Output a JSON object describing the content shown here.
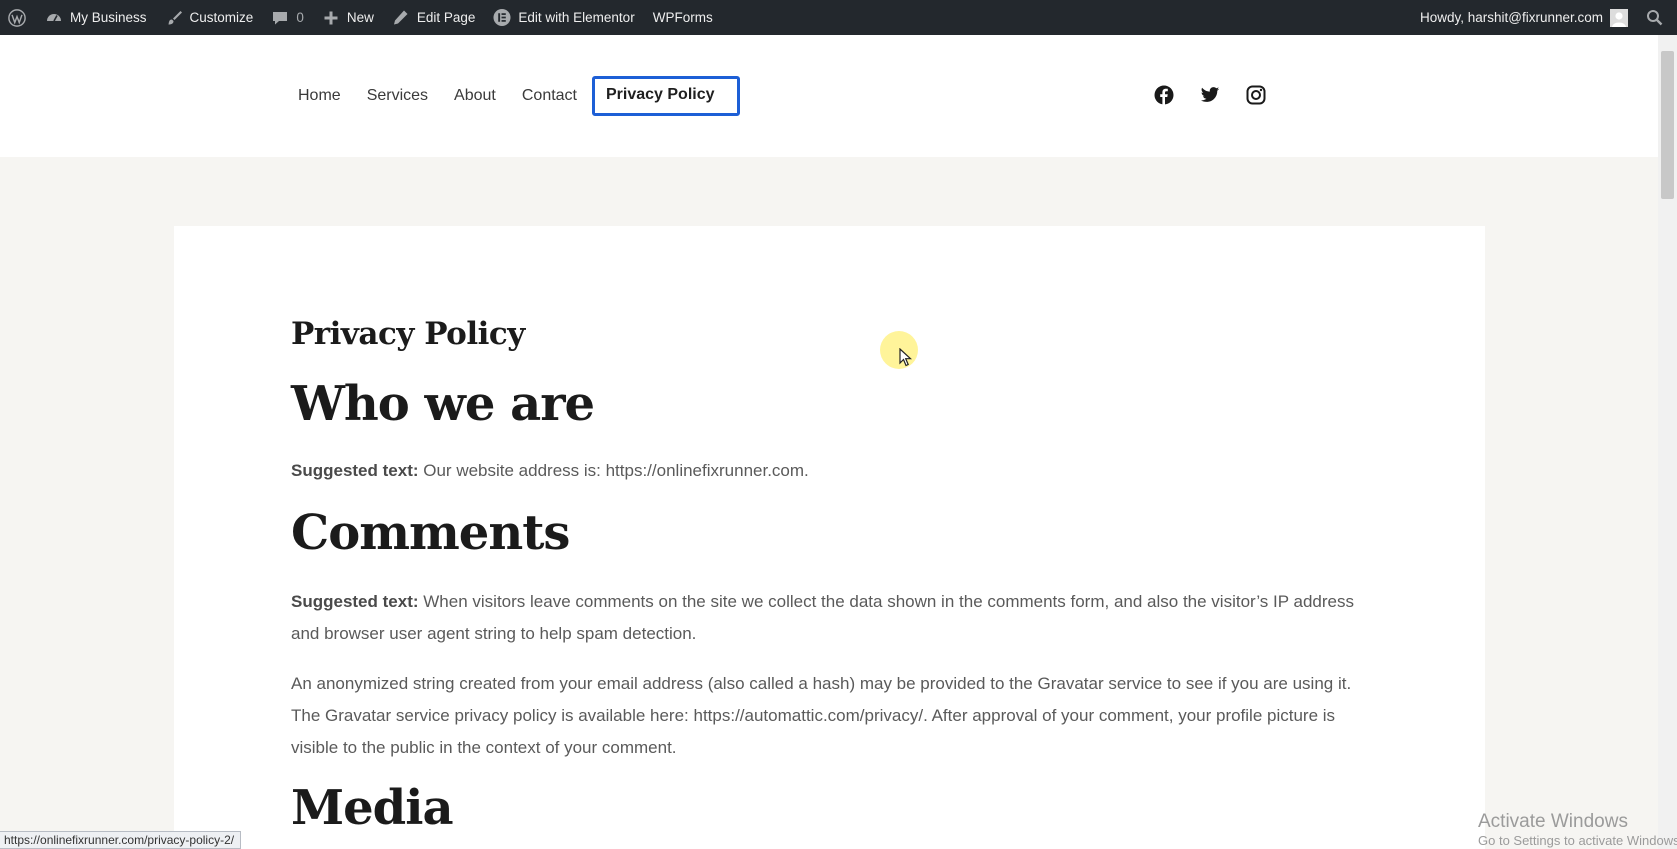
{
  "adminbar": {
    "site_name": "My Business",
    "customize": "Customize",
    "comments_count": "0",
    "new": "New",
    "edit_page": "Edit Page",
    "edit_elementor": "Edit with Elementor",
    "wpforms": "WPForms",
    "howdy": "Howdy, harshit@fixrunner.com"
  },
  "nav": {
    "items": [
      "Home",
      "Services",
      "About",
      "Contact",
      "Privacy Policy"
    ],
    "active": "Privacy Policy"
  },
  "content": {
    "page_title": "Privacy Policy",
    "who_heading": "Who we are",
    "suggested_label": "Suggested text:",
    "who_text": " Our website address is: https://onlinefixrunner.com.",
    "comments_heading": "Comments",
    "comments_text_1": " When visitors leave comments on the site we collect the data shown in the comments form, and also the visitor’s IP address and browser user agent string to help spam detection.",
    "comments_text_2": "An anonymized string created from your email address (also called a hash) may be provided to the Gravatar service to see if you are using it. The Gravatar service privacy policy is available here: https://automattic.com/privacy/. After approval of your comment, your profile picture is visible to the public in the context of your comment.",
    "media_heading": "Media"
  },
  "status_url": "https://onlinefixrunner.com/privacy-policy-2/",
  "watermark": {
    "line1": "Activate Windows",
    "line2": "Go to Settings to activate Windows."
  },
  "colors": {
    "adminbar_bg": "#23282d",
    "active_nav_border": "#1d5fd6",
    "page_bg": "#f6f5f2"
  }
}
